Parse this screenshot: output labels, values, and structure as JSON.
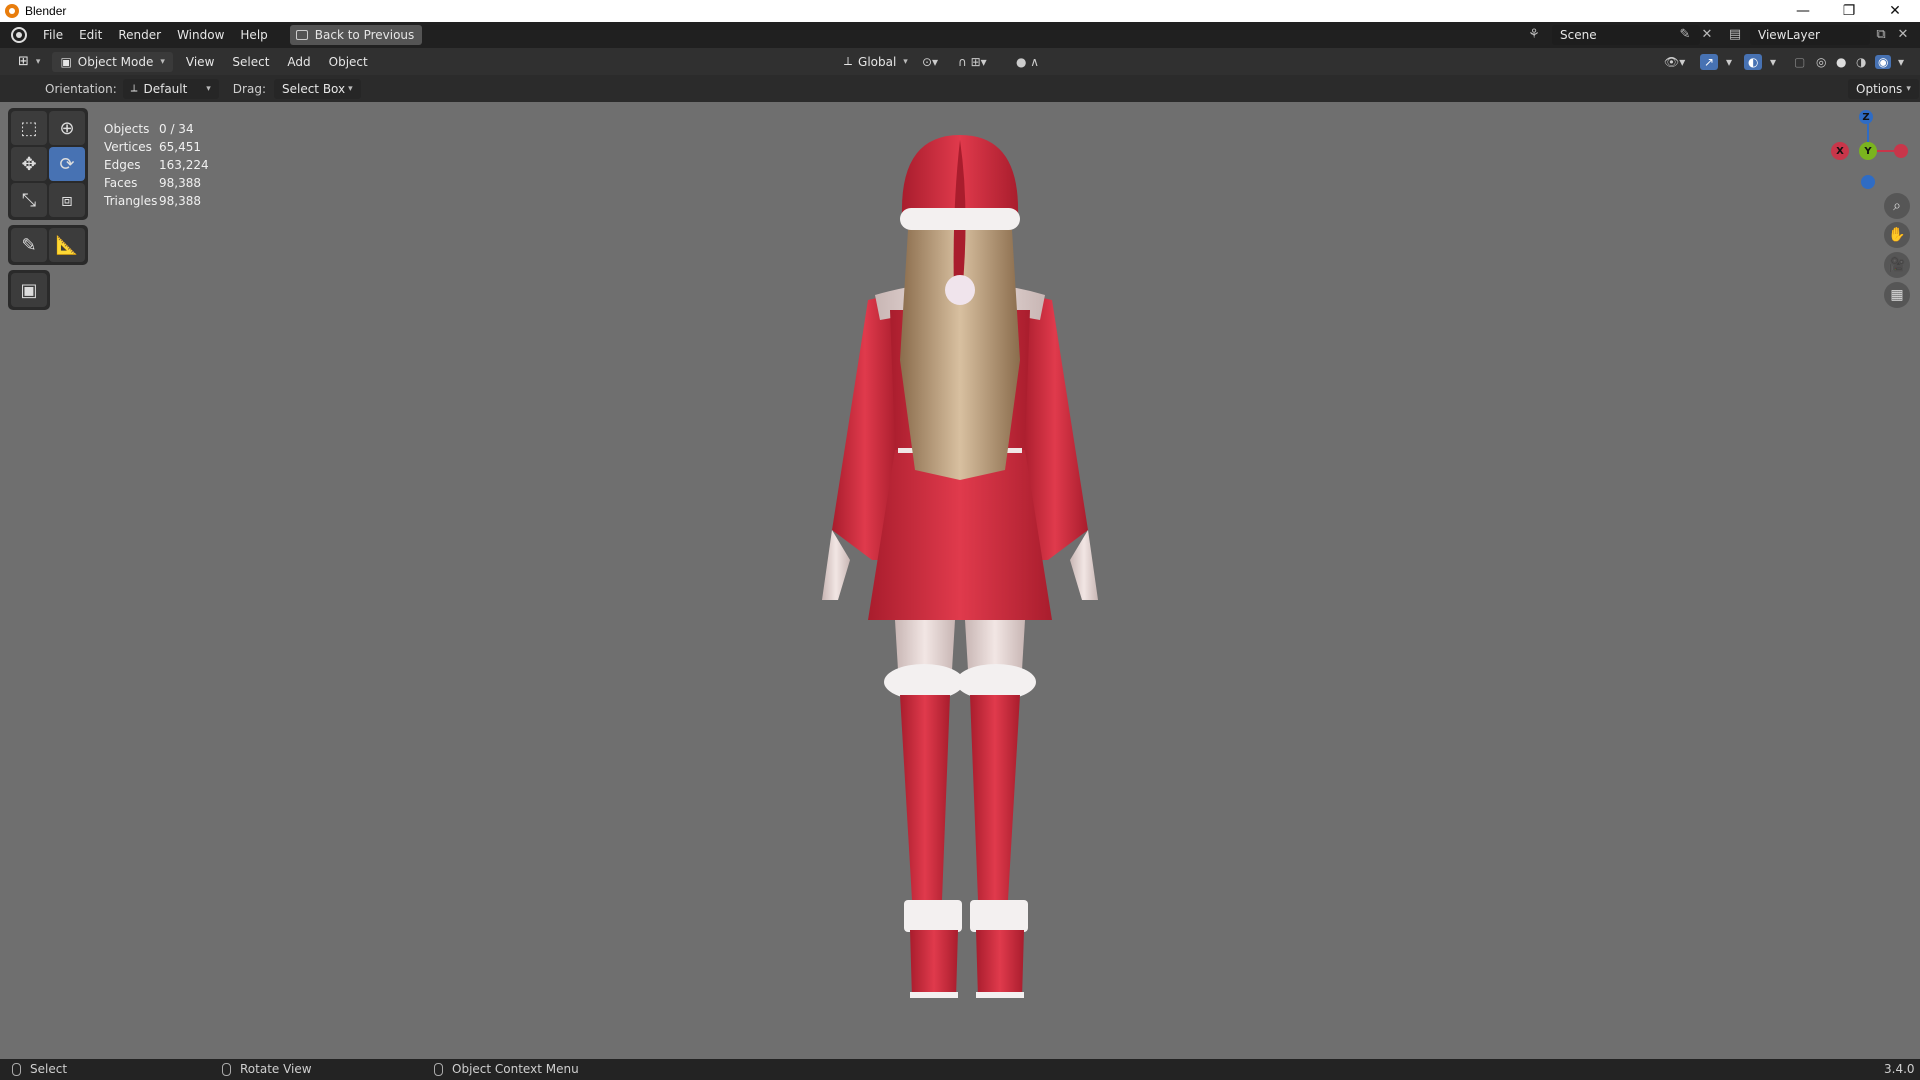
{
  "window": {
    "title": "Blender",
    "minimize": "—",
    "maximize": "❐",
    "close": "✕"
  },
  "menu": {
    "items": [
      "File",
      "Edit",
      "Render",
      "Window",
      "Help"
    ],
    "back_button": "Back to Previous"
  },
  "scene": {
    "name": "Scene",
    "view_layer": "ViewLayer"
  },
  "header": {
    "mode": "Object Mode",
    "menus": [
      "View",
      "Select",
      "Add",
      "Object"
    ],
    "transform_orientation": "Global"
  },
  "tool_header": {
    "orientation_label": "Orientation:",
    "orientation_value": "Default",
    "drag_label": "Drag:",
    "drag_value": "Select Box",
    "options": "Options"
  },
  "stats": {
    "rows": [
      {
        "label": "Objects",
        "value": "0 / 34"
      },
      {
        "label": "Vertices",
        "value": "65,451"
      },
      {
        "label": "Edges",
        "value": "163,224"
      },
      {
        "label": "Faces",
        "value": "98,388"
      },
      {
        "label": "Triangles",
        "value": "98,388"
      }
    ]
  },
  "gizmo": {
    "x": "X",
    "y": "Y",
    "z": "Z"
  },
  "status_bar": {
    "select": "Select",
    "rotate": "Rotate View",
    "context": "Object Context Menu",
    "version": "3.4.0"
  },
  "colors": {
    "accent": "#4772b3",
    "viewport_bg": "#6f6f6f",
    "x_axis": "#c8364a",
    "y_axis": "#7ab41e",
    "z_axis": "#2f6cc4"
  }
}
